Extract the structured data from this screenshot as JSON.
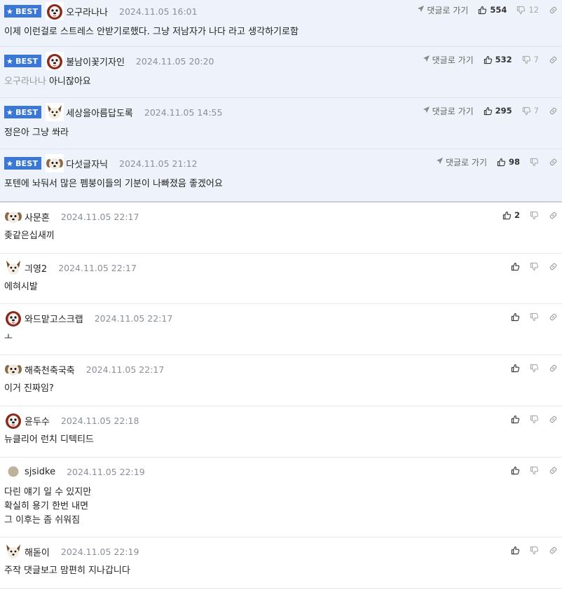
{
  "badge_label": "BEST",
  "reply_label": "댓글로 가기",
  "comments": [
    {
      "best": true,
      "avatar": "maltese-avatar",
      "nick": "오구라나나",
      "date": "2024.11.05 16:01",
      "mention": "",
      "text": "이제 이런걸로 스트레스 안받기로했다. 그냥 저남자가 나다 라고 생각하기로함",
      "likes": "554",
      "dislikes": "12"
    },
    {
      "best": true,
      "avatar": "maltese-avatar",
      "nick": "불남이꽃기자인",
      "date": "2024.11.05 20:20",
      "mention": "오구라나나",
      "text": "아니잖아요",
      "likes": "532",
      "dislikes": "7"
    },
    {
      "best": true,
      "avatar": "corgi-avatar",
      "nick": "세상을아름답도록",
      "date": "2024.11.05 14:55",
      "mention": "",
      "text": "정은아 그냥 쏴라",
      "likes": "295",
      "dislikes": "7"
    },
    {
      "best": true,
      "avatar": "puppy-avatar",
      "nick": "다섯글자닉",
      "date": "2024.11.05 21:12",
      "mention": "",
      "text": "포텐에 놔둬서 많은 펨붕이들의 기분이 나빠졌음 좋겠어요",
      "likes": "98",
      "dislikes": ""
    },
    {
      "best": false,
      "avatar": "puppy-avatar",
      "nick": "사문혼",
      "date": "2024.11.05 22:17",
      "mention": "",
      "text": "좆같은십새끼",
      "likes": "2",
      "dislikes": ""
    },
    {
      "best": false,
      "avatar": "corgi-avatar",
      "nick": "긔영2",
      "date": "2024.11.05 22:17",
      "mention": "",
      "text": "에혀시발",
      "likes": "",
      "dislikes": ""
    },
    {
      "best": false,
      "avatar": "maltese-avatar",
      "nick": "와드맡고스크랩",
      "date": "2024.11.05 22:17",
      "mention": "",
      "text": "ㅗ",
      "likes": "",
      "dislikes": ""
    },
    {
      "best": false,
      "avatar": "puppy-avatar",
      "nick": "해축천축국축",
      "date": "2024.11.05 22:17",
      "mention": "",
      "text": "이거 진짜임?",
      "likes": "",
      "dislikes": ""
    },
    {
      "best": false,
      "avatar": "maltese-avatar",
      "nick": "윤두수",
      "date": "2024.11.05 22:18",
      "mention": "",
      "text": "뉴클리어 런치 디텍티드",
      "likes": "",
      "dislikes": ""
    },
    {
      "best": false,
      "avatar": "dot-avatar",
      "nick": "sjsidke",
      "date": "2024.11.05 22:19",
      "mention": "",
      "text": "다린 얘기 일 수 있지만\n확실히 용기 한번 내면\n그 이후는 좀 쉬워짐",
      "likes": "",
      "dislikes": ""
    },
    {
      "best": false,
      "avatar": "corgi-avatar",
      "nick": "해돋이",
      "date": "2024.11.05 22:19",
      "mention": "",
      "text": "주작 댓글보고 맘편히 지나갑니다",
      "likes": "",
      "dislikes": ""
    }
  ]
}
